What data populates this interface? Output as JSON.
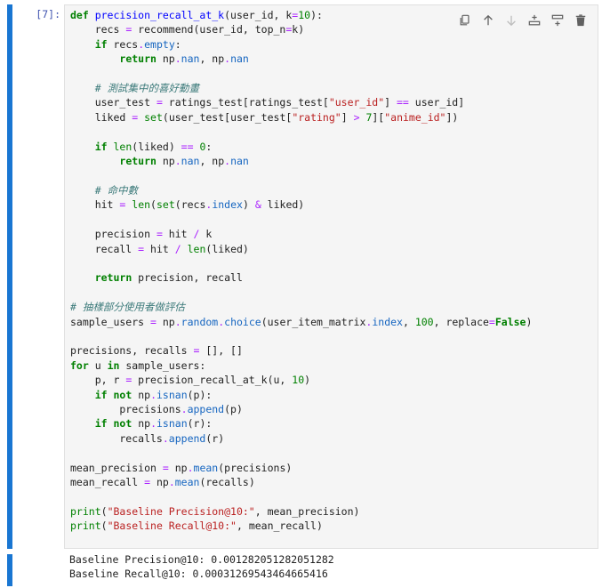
{
  "cell": {
    "prompt": "[7]:",
    "toolbar": {
      "icons": [
        "duplicate-icon",
        "move-up-icon",
        "move-down-icon",
        "insert-above-icon",
        "insert-below-icon",
        "delete-icon"
      ]
    }
  },
  "code_lines": [
    [
      [
        "k",
        "def "
      ],
      [
        "f",
        "precision_recall_at_k"
      ],
      [
        "p",
        "(user_id, k"
      ],
      [
        "o",
        "="
      ],
      [
        "n",
        "10"
      ],
      [
        "p",
        "):"
      ]
    ],
    [
      [
        "p",
        "    recs "
      ],
      [
        "o",
        "="
      ],
      [
        "p",
        " recommend(user_id, top_n"
      ],
      [
        "o",
        "="
      ],
      [
        "p",
        "k)"
      ]
    ],
    [
      [
        "p",
        "    "
      ],
      [
        "k",
        "if"
      ],
      [
        "p",
        " recs"
      ],
      [
        "o",
        "."
      ],
      [
        "a",
        "empty"
      ],
      [
        "p",
        ":"
      ]
    ],
    [
      [
        "p",
        "        "
      ],
      [
        "k",
        "return"
      ],
      [
        "p",
        " np"
      ],
      [
        "o",
        "."
      ],
      [
        "a",
        "nan"
      ],
      [
        "p",
        ", np"
      ],
      [
        "o",
        "."
      ],
      [
        "a",
        "nan"
      ]
    ],
    [
      [
        "p",
        ""
      ]
    ],
    [
      [
        "p",
        "    "
      ],
      [
        "c",
        "# 測試集中的喜好動畫"
      ]
    ],
    [
      [
        "p",
        "    user_test "
      ],
      [
        "o",
        "="
      ],
      [
        "p",
        " ratings_test[ratings_test["
      ],
      [
        "s",
        "\"user_id\""
      ],
      [
        "p",
        "] "
      ],
      [
        "o",
        "=="
      ],
      [
        "p",
        " user_id]"
      ]
    ],
    [
      [
        "p",
        "    liked "
      ],
      [
        "o",
        "="
      ],
      [
        "p",
        " "
      ],
      [
        "b",
        "set"
      ],
      [
        "p",
        "(user_test[user_test["
      ],
      [
        "s",
        "\"rating\""
      ],
      [
        "p",
        "] "
      ],
      [
        "o",
        ">"
      ],
      [
        "p",
        " "
      ],
      [
        "n",
        "7"
      ],
      [
        "p",
        "]["
      ],
      [
        "s",
        "\"anime_id\""
      ],
      [
        "p",
        "])"
      ]
    ],
    [
      [
        "p",
        ""
      ]
    ],
    [
      [
        "p",
        "    "
      ],
      [
        "k",
        "if"
      ],
      [
        "p",
        " "
      ],
      [
        "b",
        "len"
      ],
      [
        "p",
        "(liked) "
      ],
      [
        "o",
        "=="
      ],
      [
        "p",
        " "
      ],
      [
        "n",
        "0"
      ],
      [
        "p",
        ":"
      ]
    ],
    [
      [
        "p",
        "        "
      ],
      [
        "k",
        "return"
      ],
      [
        "p",
        " np"
      ],
      [
        "o",
        "."
      ],
      [
        "a",
        "nan"
      ],
      [
        "p",
        ", np"
      ],
      [
        "o",
        "."
      ],
      [
        "a",
        "nan"
      ]
    ],
    [
      [
        "p",
        ""
      ]
    ],
    [
      [
        "p",
        "    "
      ],
      [
        "c",
        "# 命中數"
      ]
    ],
    [
      [
        "p",
        "    hit "
      ],
      [
        "o",
        "="
      ],
      [
        "p",
        " "
      ],
      [
        "b",
        "len"
      ],
      [
        "p",
        "("
      ],
      [
        "b",
        "set"
      ],
      [
        "p",
        "(recs"
      ],
      [
        "o",
        "."
      ],
      [
        "a",
        "index"
      ],
      [
        "p",
        ") "
      ],
      [
        "o",
        "&"
      ],
      [
        "p",
        " liked)"
      ]
    ],
    [
      [
        "p",
        ""
      ]
    ],
    [
      [
        "p",
        "    precision "
      ],
      [
        "o",
        "="
      ],
      [
        "p",
        " hit "
      ],
      [
        "o",
        "/"
      ],
      [
        "p",
        " k"
      ]
    ],
    [
      [
        "p",
        "    recall "
      ],
      [
        "o",
        "="
      ],
      [
        "p",
        " hit "
      ],
      [
        "o",
        "/"
      ],
      [
        "p",
        " "
      ],
      [
        "b",
        "len"
      ],
      [
        "p",
        "(liked)"
      ]
    ],
    [
      [
        "p",
        ""
      ]
    ],
    [
      [
        "p",
        "    "
      ],
      [
        "k",
        "return"
      ],
      [
        "p",
        " precision, recall"
      ]
    ],
    [
      [
        "p",
        ""
      ]
    ],
    [
      [
        "c",
        "# 抽樣部分使用者做評估"
      ]
    ],
    [
      [
        "p",
        "sample_users "
      ],
      [
        "o",
        "="
      ],
      [
        "p",
        " np"
      ],
      [
        "o",
        "."
      ],
      [
        "a",
        "random"
      ],
      [
        "o",
        "."
      ],
      [
        "a",
        "choice"
      ],
      [
        "p",
        "(user_item_matrix"
      ],
      [
        "o",
        "."
      ],
      [
        "a",
        "index"
      ],
      [
        "p",
        ", "
      ],
      [
        "n",
        "100"
      ],
      [
        "p",
        ", replace"
      ],
      [
        "o",
        "="
      ],
      [
        "k",
        "False"
      ],
      [
        "p",
        ")"
      ]
    ],
    [
      [
        "p",
        ""
      ]
    ],
    [
      [
        "p",
        "precisions, recalls "
      ],
      [
        "o",
        "="
      ],
      [
        "p",
        " [], []"
      ]
    ],
    [
      [
        "k",
        "for"
      ],
      [
        "p",
        " u "
      ],
      [
        "k",
        "in"
      ],
      [
        "p",
        " sample_users:"
      ]
    ],
    [
      [
        "p",
        "    p, r "
      ],
      [
        "o",
        "="
      ],
      [
        "p",
        " precision_recall_at_k(u, "
      ],
      [
        "n",
        "10"
      ],
      [
        "p",
        ")"
      ]
    ],
    [
      [
        "p",
        "    "
      ],
      [
        "k",
        "if"
      ],
      [
        "p",
        " "
      ],
      [
        "k",
        "not"
      ],
      [
        "p",
        " np"
      ],
      [
        "o",
        "."
      ],
      [
        "a",
        "isnan"
      ],
      [
        "p",
        "(p):"
      ]
    ],
    [
      [
        "p",
        "        precisions"
      ],
      [
        "o",
        "."
      ],
      [
        "a",
        "append"
      ],
      [
        "p",
        "(p)"
      ]
    ],
    [
      [
        "p",
        "    "
      ],
      [
        "k",
        "if"
      ],
      [
        "p",
        " "
      ],
      [
        "k",
        "not"
      ],
      [
        "p",
        " np"
      ],
      [
        "o",
        "."
      ],
      [
        "a",
        "isnan"
      ],
      [
        "p",
        "(r):"
      ]
    ],
    [
      [
        "p",
        "        recalls"
      ],
      [
        "o",
        "."
      ],
      [
        "a",
        "append"
      ],
      [
        "p",
        "(r)"
      ]
    ],
    [
      [
        "p",
        ""
      ]
    ],
    [
      [
        "p",
        "mean_precision "
      ],
      [
        "o",
        "="
      ],
      [
        "p",
        " np"
      ],
      [
        "o",
        "."
      ],
      [
        "a",
        "mean"
      ],
      [
        "p",
        "(precisions)"
      ]
    ],
    [
      [
        "p",
        "mean_recall "
      ],
      [
        "o",
        "="
      ],
      [
        "p",
        " np"
      ],
      [
        "o",
        "."
      ],
      [
        "a",
        "mean"
      ],
      [
        "p",
        "(recalls)"
      ]
    ],
    [
      [
        "p",
        ""
      ]
    ],
    [
      [
        "b",
        "print"
      ],
      [
        "p",
        "("
      ],
      [
        "s",
        "\"Baseline Precision@10:\""
      ],
      [
        "p",
        ", mean_precision)"
      ]
    ],
    [
      [
        "b",
        "print"
      ],
      [
        "p",
        "("
      ],
      [
        "s",
        "\"Baseline Recall@10:\""
      ],
      [
        "p",
        ", mean_recall)"
      ]
    ]
  ],
  "output_lines": [
    "Baseline Precision@10: 0.001282051282051282",
    "Baseline Recall@10: 0.00031269543464665416"
  ]
}
